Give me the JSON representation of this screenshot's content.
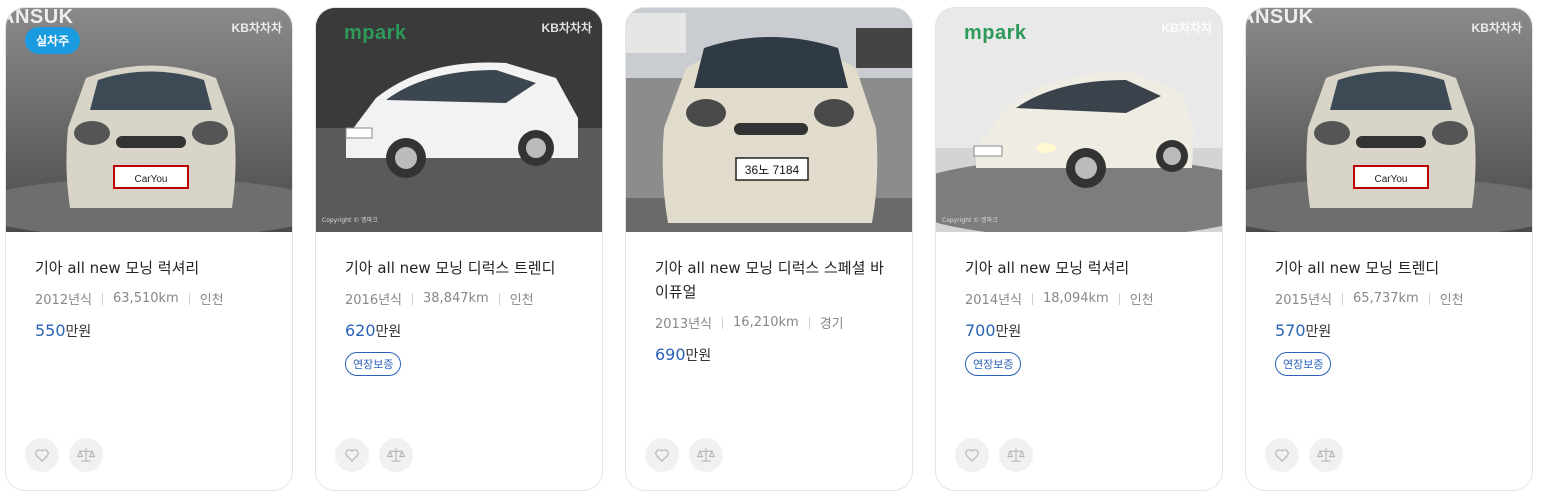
{
  "cards": [
    {
      "brand": "ANSUK",
      "kb": "KB차차차",
      "badge": "실차주",
      "plate_text": "CarYou",
      "title": "기아 all new 모닝 럭셔리",
      "year": "2012년식",
      "mileage": "63,510km",
      "region": "인천",
      "price_num": "550",
      "price_unit": "만원",
      "warranty": ""
    },
    {
      "brand": "mpark",
      "kb": "KB차차차",
      "plate_text": "",
      "copyright": "Copyright © 엠파크",
      "title": "기아 all new 모닝 디럭스 트렌디",
      "year": "2016년식",
      "mileage": "38,847km",
      "region": "인천",
      "price_num": "620",
      "price_unit": "만원",
      "warranty": "연장보증"
    },
    {
      "brand": "",
      "kb": "",
      "plate_text": "36노 7184",
      "title": "기아 all new 모닝 디럭스 스페셜 바이퓨얼",
      "year": "2013년식",
      "mileage": "16,210km",
      "region": "경기",
      "price_num": "690",
      "price_unit": "만원",
      "warranty": ""
    },
    {
      "brand": "mpark",
      "kb": "KB차차차",
      "plate_text": "",
      "copyright": "Copyright © 엠파크",
      "title": "기아 all new 모닝 럭셔리",
      "year": "2014년식",
      "mileage": "18,094km",
      "region": "인천",
      "price_num": "700",
      "price_unit": "만원",
      "warranty": "연장보증"
    },
    {
      "brand": "ANSUK",
      "kb": "KB차차차",
      "plate_text": "CarYou",
      "title": "기아 all new 모닝 트렌디",
      "year": "2015년식",
      "mileage": "65,737km",
      "region": "인천",
      "price_num": "570",
      "price_unit": "만원",
      "warranty": "연장보증"
    }
  ],
  "icons": {
    "like": "heart-icon",
    "compare": "scale-icon"
  },
  "colors": {
    "price": "#2a62b6",
    "badge": "#1a9be0",
    "mpark": "#2d9a5a"
  }
}
